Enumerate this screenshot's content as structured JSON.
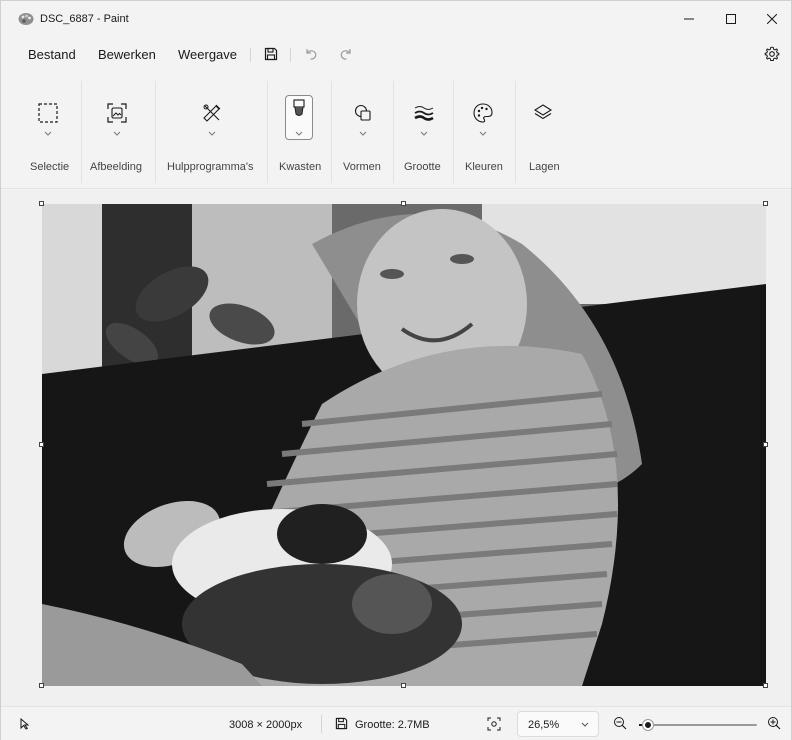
{
  "window": {
    "title": "DSC_6887 - Paint",
    "app_icon": "paint-palette-icon"
  },
  "menu": {
    "file": "Bestand",
    "edit": "Bewerken",
    "view": "Weergave",
    "save_icon": "save-icon",
    "undo_icon": "undo-icon",
    "redo_icon": "redo-icon",
    "settings_icon": "gear-icon"
  },
  "ribbon": {
    "groups": [
      {
        "label": "Selectie",
        "icon": "selection-icon"
      },
      {
        "label": "Afbeelding",
        "icon": "image-icon"
      },
      {
        "label": "Hulpprogramma's",
        "icon": "tools-icon"
      },
      {
        "label": "Kwasten",
        "icon": "brush-icon"
      },
      {
        "label": "Vormen",
        "icon": "shapes-icon"
      },
      {
        "label": "Grootte",
        "icon": "size-icon"
      },
      {
        "label": "Kleuren",
        "icon": "palette-icon"
      },
      {
        "label": "Lagen",
        "icon": "layers-icon"
      }
    ]
  },
  "canvas": {
    "image_description_icon": "photo-canvas"
  },
  "status": {
    "dimensions": "3008 × 2000px",
    "size": "Grootte: 2.7MB",
    "zoom": "26,5%",
    "zoom_fraction": 0.08,
    "colors": {
      "accent": "#1a1a1a"
    }
  }
}
